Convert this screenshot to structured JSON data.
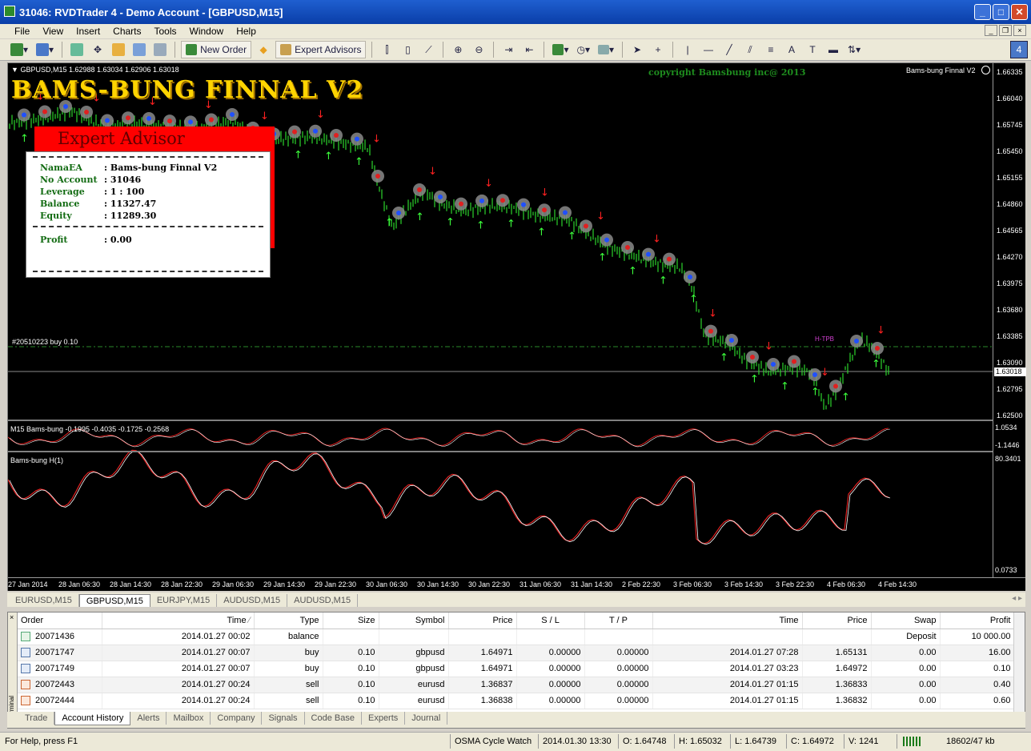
{
  "window": {
    "title": "31046: RVDTrader 4 - Demo Account - [GBPUSD,M15]"
  },
  "menu": [
    "File",
    "View",
    "Insert",
    "Charts",
    "Tools",
    "Window",
    "Help"
  ],
  "toolbar": {
    "new_order": "New Order",
    "expert_advisors": "Expert Advisors",
    "badge": "4"
  },
  "chart": {
    "header": "GBPUSD,M15  1.62988 1.63034 1.62906 1.63018",
    "title": "BAMS-BUNG FINNAL V2",
    "copyright": "copyright Bamsbung inc@ 2013",
    "ea_label": "Bams-bung Finnal V2",
    "price_levels": [
      "1.66335",
      "1.66040",
      "1.65745",
      "1.65450",
      "1.65155",
      "1.64860",
      "1.64565",
      "1.64270",
      "1.63975",
      "1.63680",
      "1.63385",
      "1.63090",
      "1.62795",
      "1.62500"
    ],
    "current_price": "1.63018",
    "order_line": "#20510223 buy 0.10",
    "hitp_label": "H-TPB",
    "osc1_label": "M15  Bams-bung  -0.1995 -0.4035 -0.1725 -0.2568",
    "osc1_scale": [
      "1.0534",
      "-1.1446"
    ],
    "osc2_label": "Bams-bung H(1)",
    "osc2_scale": [
      "80.3401",
      "0.0733"
    ],
    "time_labels": [
      "27 Jan 2014",
      "28 Jan 06:30",
      "28 Jan 14:30",
      "28 Jan 22:30",
      "29 Jan 06:30",
      "29 Jan 14:30",
      "29 Jan 22:30",
      "30 Jan 06:30",
      "30 Jan 14:30",
      "30 Jan 22:30",
      "31 Jan 06:30",
      "31 Jan 14:30",
      "2 Feb 22:30",
      "3 Feb 06:30",
      "3 Feb 14:30",
      "3 Feb 22:30",
      "4 Feb 06:30",
      "4 Feb 14:30"
    ]
  },
  "ea_panel": {
    "header": "Expert Advisor",
    "rows": [
      {
        "label": "NamaEA",
        "value": ": Bams-bung Finnal V2"
      },
      {
        "label": "No Account",
        "value": ": 31046"
      },
      {
        "label": "Leverage",
        "value": ": 1 : 100"
      },
      {
        "label": "Balance",
        "value": ": 11327.47"
      },
      {
        "label": "Equity",
        "value": ": 11289.30"
      }
    ],
    "profit_label": "Profit",
    "profit_value": ": 0.00"
  },
  "symbol_tabs": [
    "EURUSD,M15",
    "GBPUSD,M15",
    "EURJPY,M15",
    "AUDUSD,M15",
    "AUDUSD,M15"
  ],
  "terminal": {
    "side_label": "Terminal",
    "columns": [
      "Order",
      "Time",
      "Type",
      "Size",
      "Symbol",
      "Price",
      "S / L",
      "T / P",
      "Time",
      "Price",
      "Swap",
      "Profit"
    ],
    "rows": [
      {
        "icon": "balance",
        "order": "20071436",
        "time": "2014.01.27 00:02",
        "type": "balance",
        "size": "",
        "symbol": "",
        "price": "",
        "sl": "",
        "tp": "",
        "ctime": "",
        "cprice": "",
        "swap": "Deposit",
        "profit": "10 000.00"
      },
      {
        "icon": "buy",
        "order": "20071747",
        "time": "2014.01.27 00:07",
        "type": "buy",
        "size": "0.10",
        "symbol": "gbpusd",
        "price": "1.64971",
        "sl": "0.00000",
        "tp": "0.00000",
        "ctime": "2014.01.27 07:28",
        "cprice": "1.65131",
        "swap": "0.00",
        "profit": "16.00"
      },
      {
        "icon": "buy",
        "order": "20071749",
        "time": "2014.01.27 00:07",
        "type": "buy",
        "size": "0.10",
        "symbol": "gbpusd",
        "price": "1.64971",
        "sl": "0.00000",
        "tp": "0.00000",
        "ctime": "2014.01.27 03:23",
        "cprice": "1.64972",
        "swap": "0.00",
        "profit": "0.10"
      },
      {
        "icon": "sell",
        "order": "20072443",
        "time": "2014.01.27 00:24",
        "type": "sell",
        "size": "0.10",
        "symbol": "eurusd",
        "price": "1.36837",
        "sl": "0.00000",
        "tp": "0.00000",
        "ctime": "2014.01.27 01:15",
        "cprice": "1.36833",
        "swap": "0.00",
        "profit": "0.40"
      },
      {
        "icon": "sell",
        "order": "20072444",
        "time": "2014.01.27 00:24",
        "type": "sell",
        "size": "0.10",
        "symbol": "eurusd",
        "price": "1.36838",
        "sl": "0.00000",
        "tp": "0.00000",
        "ctime": "2014.01.27 01:15",
        "cprice": "1.36832",
        "swap": "0.00",
        "profit": "0.60"
      }
    ],
    "tabs": [
      "Trade",
      "Account History",
      "Alerts",
      "Mailbox",
      "Company",
      "Signals",
      "Code Base",
      "Experts",
      "Journal"
    ],
    "active_tab": "Account History"
  },
  "status": {
    "help": "For Help, press F1",
    "profile": "OSMA Cycle Watch",
    "datetime": "2014.01.30 13:30",
    "open": "O: 1.64748",
    "high": "H: 1.65032",
    "low": "L: 1.64739",
    "close": "C: 1.64972",
    "volume": "V: 1241",
    "traffic": "18602/47 kb"
  }
}
